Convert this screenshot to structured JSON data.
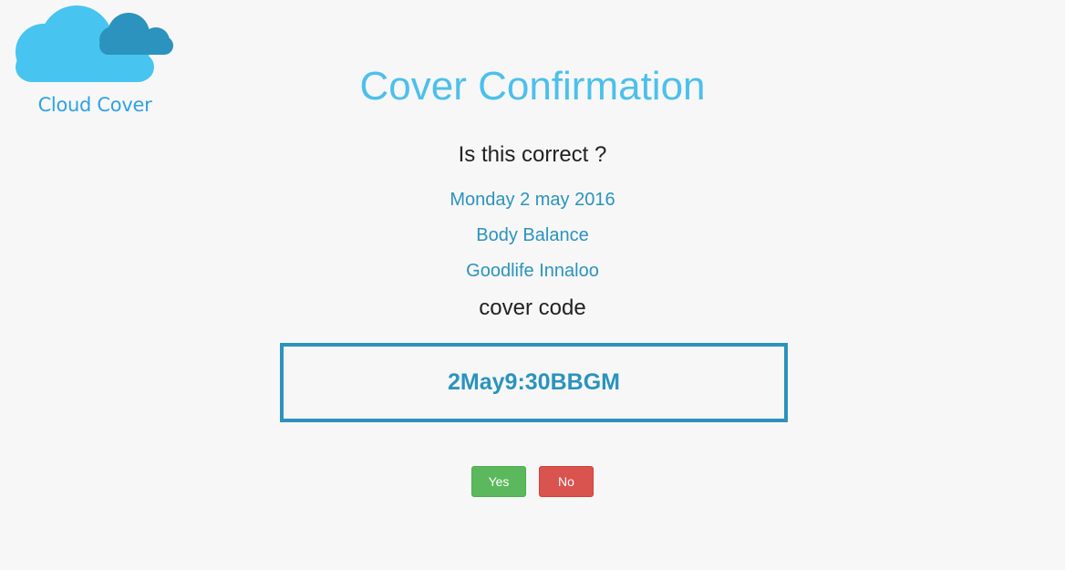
{
  "logo": {
    "text": "Cloud Cover",
    "icon": "cloud-icon",
    "colors": {
      "front_cloud": "#48c4f0",
      "back_cloud": "#2b93bd",
      "text": "#2ea3e0"
    }
  },
  "header": {
    "title": "Cover Confirmation"
  },
  "confirmation": {
    "question": "Is this correct ?",
    "date": "Monday 2 may 2016",
    "class_name": "Body Balance",
    "location": "Goodlife Innaloo",
    "code_label": "cover code",
    "code_value": "2May9:30BBGM"
  },
  "buttons": {
    "yes_label": "Yes",
    "no_label": "No"
  },
  "colors": {
    "background": "#f7f7f7",
    "title": "#4cc0ec",
    "accent": "#2b93bd",
    "yes": "#5cb85c",
    "no": "#d9534f"
  }
}
